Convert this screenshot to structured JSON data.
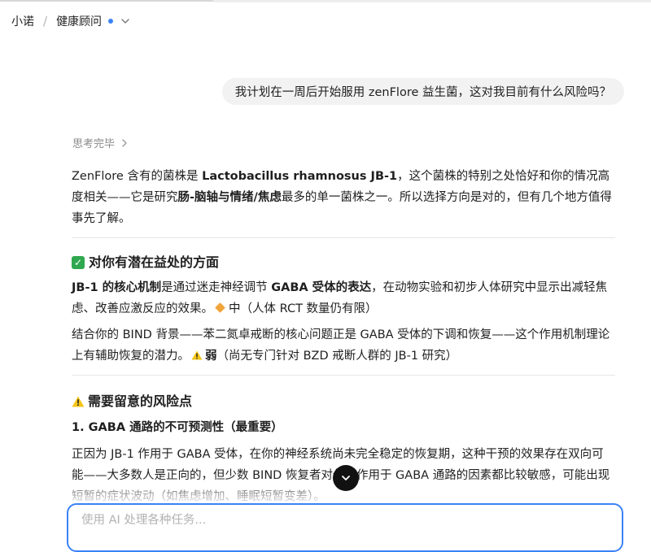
{
  "header": {
    "app_name": "小诺",
    "separator": "/",
    "agent_name": "健康顾问"
  },
  "user_message": "我计划在一周后开始服用 zenFlore 益生菌，这对我目前有什么风险吗？",
  "thinking_label": "思考完毕",
  "intro": {
    "t1": "ZenFlore 含有的菌株是 ",
    "b1": "Lactobacillus rhamnosus JB-1",
    "t2": "，这个菌株的特别之处恰好和你的情况高度相关——它是研究",
    "b2": "肠-脑轴与情绪/焦虑",
    "t3": "最多的单一菌株之一。所以选择方向是对的，但有几个地方值得事先了解。"
  },
  "benefits": {
    "heading": "对你有潜在益处的方面",
    "p1_bold": "JB-1 的核心机制",
    "p1_t1": "是通过迷走神经调节 ",
    "p1_bold2": "GABA 受体的表达",
    "p1_t2": "，在动物实验和初步人体研究中显示出减轻焦虑、改善应激反应的效果。",
    "p1_rating": "中",
    "p1_note": "（人体 RCT 数量仍有限）",
    "p2_text": "结合你的 BIND 背景——苯二氮卓戒断的核心问题正是 GABA 受体的下调和恢复——这个作用机制理论上有辅助恢复的潜力。",
    "p2_rating": "弱",
    "p2_note": "（尚无专门针对 BZD 戒断人群的 JB-1 研究）"
  },
  "risks": {
    "heading": "需要留意的风险点",
    "sub1": "1. GABA 通路的不可预测性（最重要）",
    "p1": "正因为 JB-1 作用于 GABA 受体，在你的神经系统尚未完全稳定的恢复期，这种干预的效果存在双向可能——大多数人是正向的，但少数 BIND 恢复者对任何作用于 GABA 通路的因素都比较敏感，可能出现短暂的症状波动（如焦虑增加、睡眠短暂变差）。"
  },
  "input": {
    "placeholder": "使用 AI 处理各种任务..."
  },
  "colors": {
    "accent": "#3b82f6",
    "bubble_bg": "#f2f2f3",
    "check_green": "#2fa84f",
    "warn_yellow": "#f5c518",
    "rating_orange": "#f0a43a"
  }
}
